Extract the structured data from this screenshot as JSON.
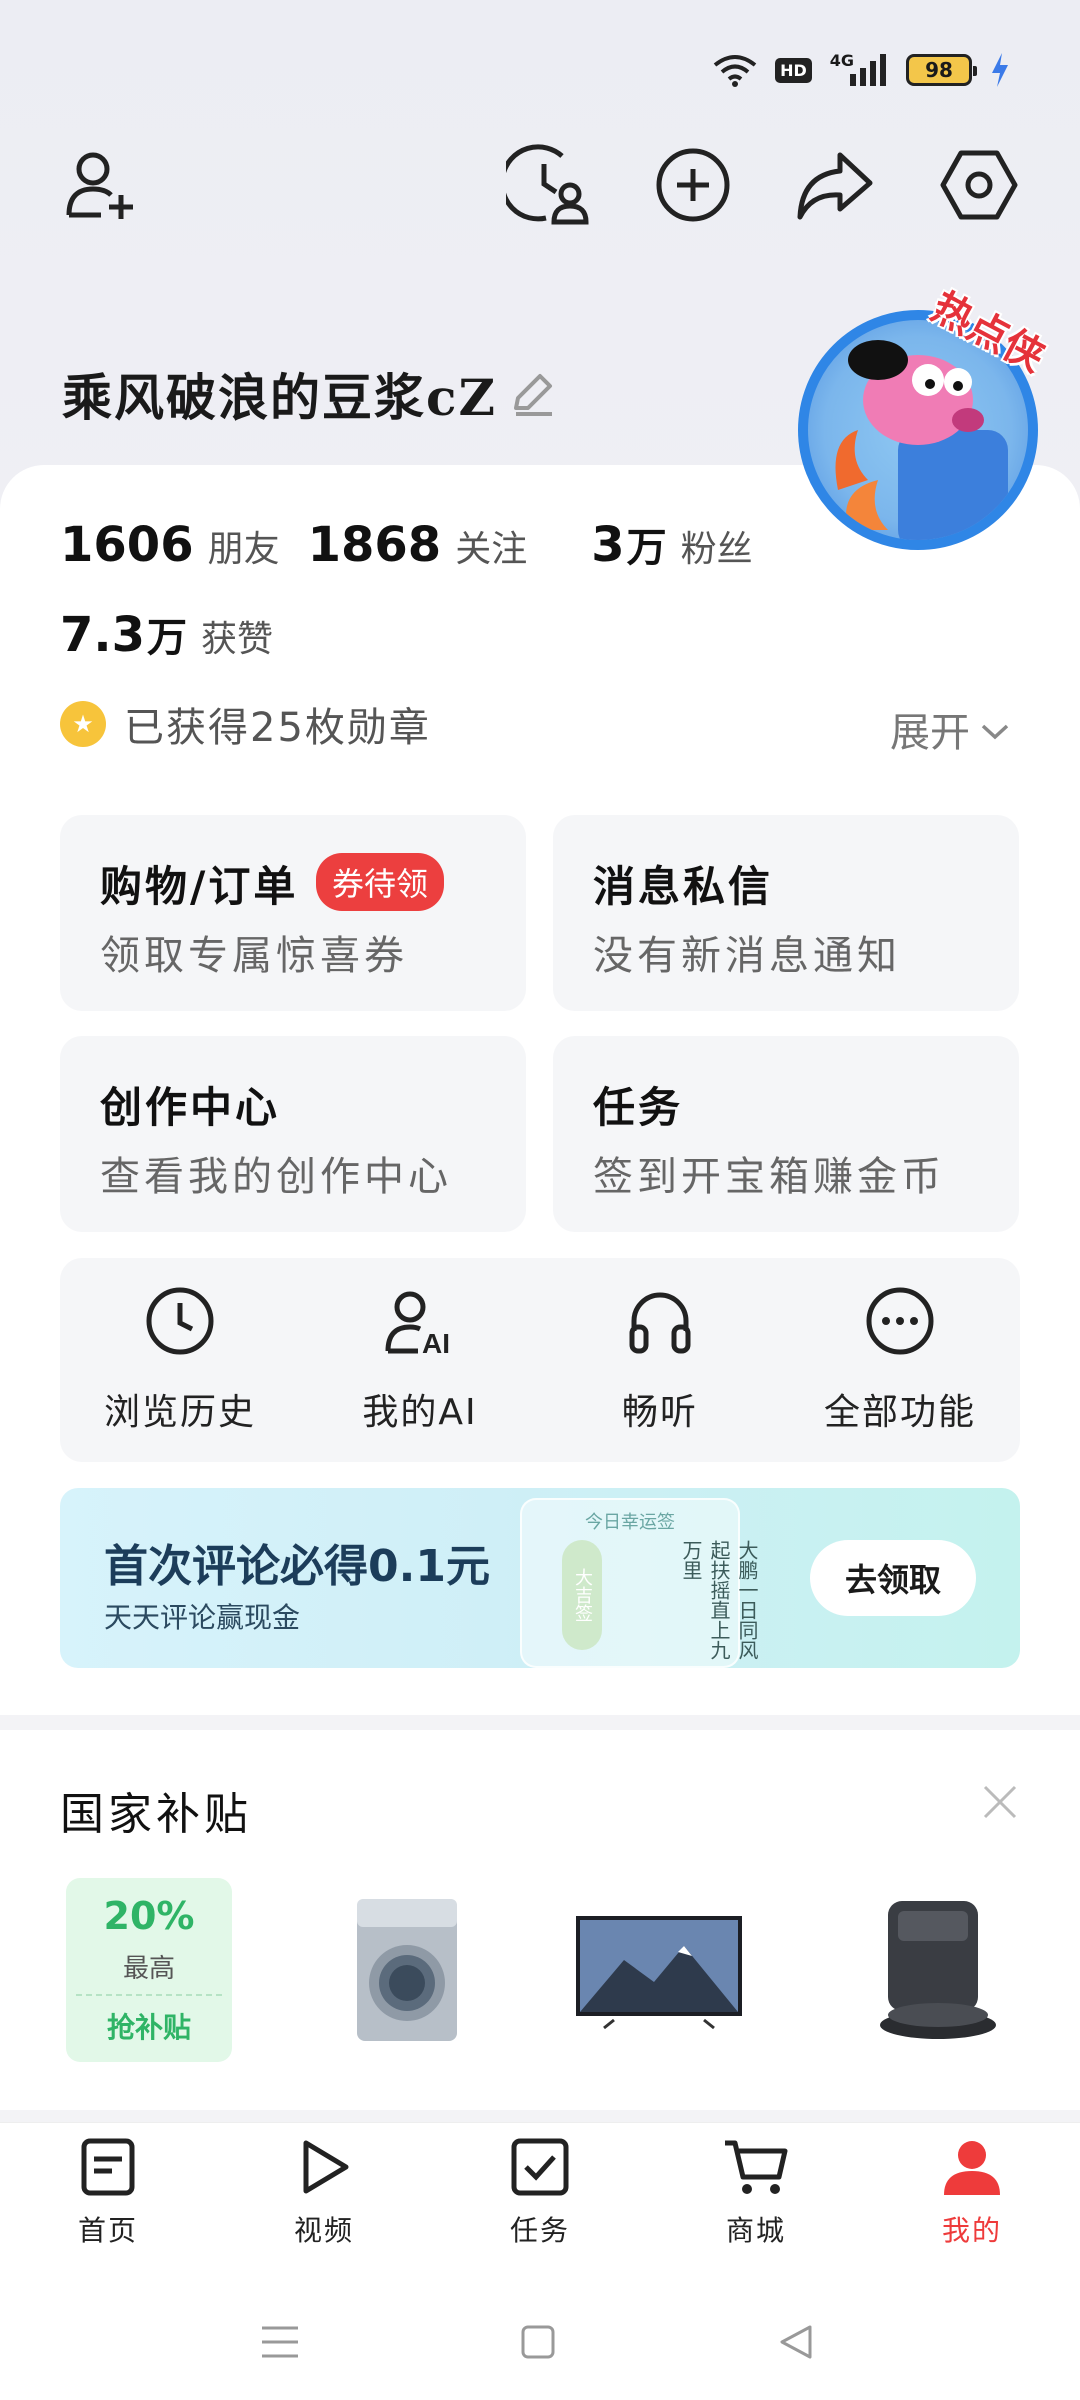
{
  "status_bar": {
    "hd_label": "HD",
    "network_label": "4G",
    "battery_level": "98"
  },
  "header": {
    "add_friend_icon": "add-user-icon",
    "history_user_icon": "clock-user-icon",
    "add_icon": "plus-circle-icon",
    "share_icon": "share-icon",
    "settings_icon": "settings-icon"
  },
  "profile": {
    "username": "乘风破浪的豆浆cZ",
    "avatar_badge": "热点侠"
  },
  "stats": {
    "friends_num": "1606",
    "friends_label": "朋友",
    "following_num": "1868",
    "following_label": "关注",
    "fans_num": "3",
    "fans_unit": "万",
    "fans_label": "粉丝",
    "likes_num": "7.3",
    "likes_unit": "万",
    "likes_label": "获赞"
  },
  "medals": {
    "text": "已获得25枚勋章",
    "expand_label": "展开"
  },
  "tiles": [
    {
      "title": "购物/订单",
      "badge": "券待领",
      "subtitle": "领取专属惊喜券"
    },
    {
      "title": "消息私信",
      "subtitle": "没有新消息通知"
    },
    {
      "title": "创作中心",
      "subtitle": "查看我的创作中心"
    },
    {
      "title": "任务",
      "subtitle": "签到开宝箱赚金币"
    }
  ],
  "quick_actions": [
    {
      "label": "浏览历史",
      "icon": "clock-icon"
    },
    {
      "label": "我的AI",
      "icon": "ai-user-icon"
    },
    {
      "label": "畅听",
      "icon": "headphones-icon"
    },
    {
      "label": "全部功能",
      "icon": "more-icon"
    }
  ],
  "banner": {
    "title": "首次评论必得0.1元",
    "subtitle": "天天评论赢现金",
    "card_head": "今日幸运签",
    "card_seal": "大吉签",
    "card_poem": "大鹏一日同风起扶摇直上九万里",
    "button": "去领取"
  },
  "subsidy": {
    "title": "国家补贴",
    "promo_percent": "20%",
    "promo_label": "最高",
    "promo_action": "抢补贴",
    "products": [
      "washing-machine",
      "television",
      "robot-vacuum"
    ]
  },
  "tab_bar": [
    {
      "label": "首页",
      "icon": "home-doc-icon"
    },
    {
      "label": "视频",
      "icon": "play-icon"
    },
    {
      "label": "任务",
      "icon": "task-check-icon"
    },
    {
      "label": "商城",
      "icon": "cart-icon"
    },
    {
      "label": "我的",
      "icon": "profile-icon",
      "active": true
    }
  ],
  "colors": {
    "accent_red": "#ee3b3b",
    "promo_green": "#2fb466",
    "banner_bg": "#d7f3fb"
  }
}
